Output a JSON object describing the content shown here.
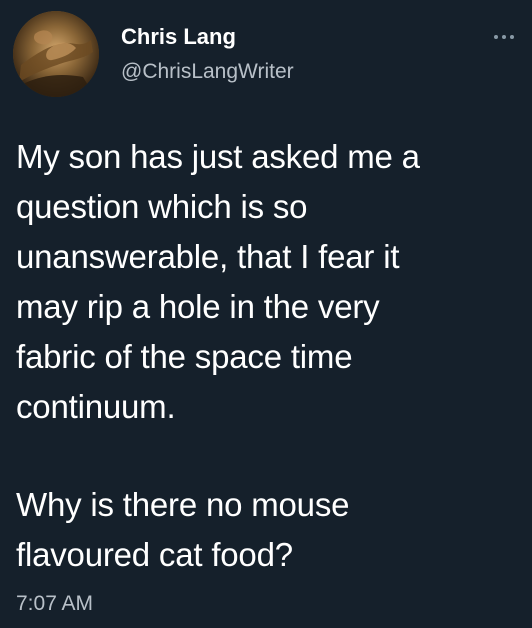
{
  "author": {
    "name": "Chris Lang",
    "handle": "@ChrisLangWriter"
  },
  "tweet": {
    "paragraph_1": "My son has just asked me a\nquestion which is so\nunanswerable, that I fear it\nmay rip a hole in the very\nfabric of the space time\ncontinuum.",
    "paragraph_2": "Why is there no mouse\nflavoured cat food?",
    "time": "7:07 AM"
  },
  "icons": {
    "avatar": "avatar-image",
    "menu": "more-options-icon"
  },
  "colors": {
    "background": "#15202b",
    "text": "#ffffff",
    "secondary_text": "#b8c0c8",
    "icon": "#8899a6"
  }
}
